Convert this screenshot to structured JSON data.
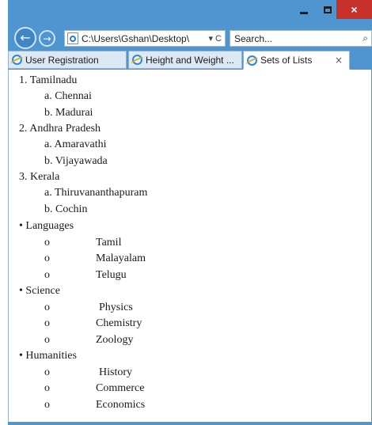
{
  "window": {
    "controls": {
      "close": "×"
    }
  },
  "nav": {
    "back_glyph": "←",
    "forward_glyph": "→",
    "address": "C:\\Users\\Gshan\\Desktop\\",
    "address_ctrl": "▾ C",
    "search_placeholder": "Search...",
    "search_glyph": "⌕"
  },
  "tabs": [
    {
      "label": "User Registration",
      "active": false
    },
    {
      "label": "Height and Weight ...",
      "active": false
    },
    {
      "label": "Sets of Lists",
      "active": true,
      "close": "×"
    }
  ],
  "content": {
    "states": [
      {
        "marker": "1.",
        "name": "Tamilnadu",
        "cities": [
          {
            "marker": "a.",
            "name": "Chennai"
          },
          {
            "marker": "b.",
            "name": "Madurai"
          }
        ]
      },
      {
        "marker": "2.",
        "name": "Andhra Pradesh",
        "cities": [
          {
            "marker": "a.",
            "name": "Amaravathi"
          },
          {
            "marker": "b.",
            "name": "Vijayawada"
          }
        ]
      },
      {
        "marker": "3.",
        "name": "Kerala",
        "cities": [
          {
            "marker": "a.",
            "name": "Thiruvananthapuram"
          },
          {
            "marker": "b.",
            "name": "Cochin"
          }
        ]
      }
    ],
    "groups": [
      {
        "marker": "•",
        "name": "Languages",
        "items": [
          {
            "marker": "o",
            "name": "Tamil"
          },
          {
            "marker": "o",
            "name": "Malayalam"
          },
          {
            "marker": "o",
            "name": "Telugu"
          }
        ]
      },
      {
        "marker": "•",
        "name": "Science",
        "items": [
          {
            "marker": "o",
            "name": "Physics"
          },
          {
            "marker": "o",
            "name": "Chemistry"
          },
          {
            "marker": "o",
            "name": "Zoology"
          }
        ]
      },
      {
        "marker": "•",
        "name": "Humanities",
        "items": [
          {
            "marker": "o",
            "name": "History"
          },
          {
            "marker": "o",
            "name": "Commerce"
          },
          {
            "marker": "o",
            "name": "Economics"
          }
        ]
      }
    ]
  }
}
